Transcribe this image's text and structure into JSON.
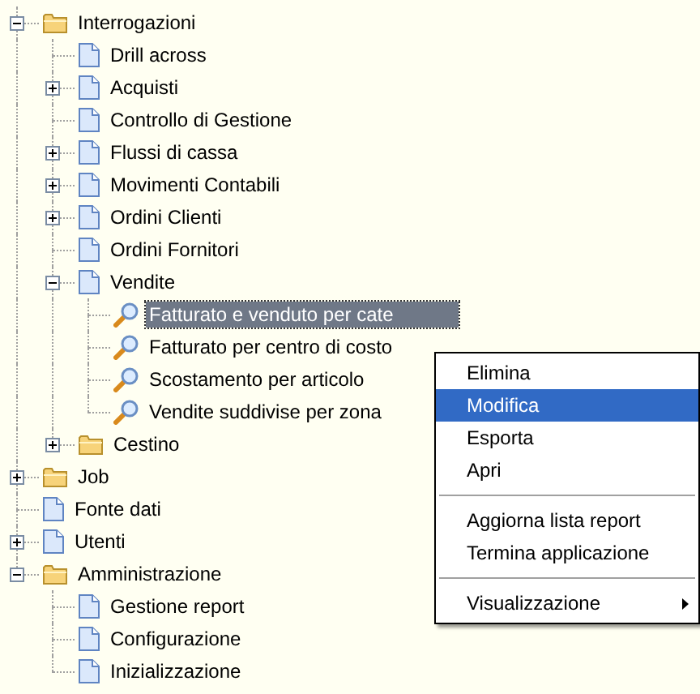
{
  "tree": [
    {
      "label": "Interrogazioni",
      "kind": "folder",
      "expanded": true,
      "selected": false,
      "children": [
        {
          "label": "Drill across",
          "kind": "page",
          "selected": false
        },
        {
          "label": "Acquisti",
          "kind": "page",
          "expanded": false,
          "selected": false
        },
        {
          "label": "Controllo di Gestione",
          "kind": "page",
          "selected": false
        },
        {
          "label": "Flussi di cassa",
          "kind": "page",
          "expanded": false,
          "selected": false
        },
        {
          "label": "Movimenti Contabili",
          "kind": "page",
          "expanded": false,
          "selected": false
        },
        {
          "label": "Ordini Clienti",
          "kind": "page",
          "expanded": false,
          "selected": false
        },
        {
          "label": "Ordini Fornitori",
          "kind": "page",
          "selected": false
        },
        {
          "label": "Vendite",
          "kind": "page",
          "expanded": true,
          "selected": false,
          "children": [
            {
              "label": "Fatturato e venduto per cate",
              "kind": "query",
              "selected": true
            },
            {
              "label": "Fatturato per centro di costo",
              "kind": "query",
              "selected": false
            },
            {
              "label": "Scostamento per articolo",
              "kind": "query",
              "selected": false
            },
            {
              "label": "Vendite suddivise per zona",
              "kind": "query",
              "selected": false
            }
          ]
        },
        {
          "label": "Cestino",
          "kind": "folder",
          "expanded": false,
          "selected": false
        }
      ]
    },
    {
      "label": "Job",
      "kind": "folder",
      "expanded": false,
      "selected": false
    },
    {
      "label": "Fonte dati",
      "kind": "page",
      "selected": false
    },
    {
      "label": "Utenti",
      "kind": "page",
      "expanded": false,
      "selected": false
    },
    {
      "label": "Amministrazione",
      "kind": "folder",
      "expanded": true,
      "selected": false,
      "children": [
        {
          "label": "Gestione report",
          "kind": "page",
          "selected": false
        },
        {
          "label": "Configurazione",
          "kind": "page",
          "selected": false
        },
        {
          "label": "Inizializzazione",
          "kind": "page",
          "selected": false
        }
      ]
    }
  ],
  "context_menu": [
    {
      "kind": "item",
      "label": "Elimina",
      "selected": false
    },
    {
      "kind": "item",
      "label": "Modifica",
      "selected": true
    },
    {
      "kind": "item",
      "label": "Esporta",
      "selected": false
    },
    {
      "kind": "item",
      "label": "Apri",
      "selected": false
    },
    {
      "kind": "separator"
    },
    {
      "kind": "item",
      "label": "Aggiorna lista report",
      "selected": false
    },
    {
      "kind": "item",
      "label": "Termina applicazione",
      "selected": false
    },
    {
      "kind": "separator"
    },
    {
      "kind": "item",
      "label": "Visualizzazione",
      "selected": false,
      "submenu": true
    }
  ]
}
